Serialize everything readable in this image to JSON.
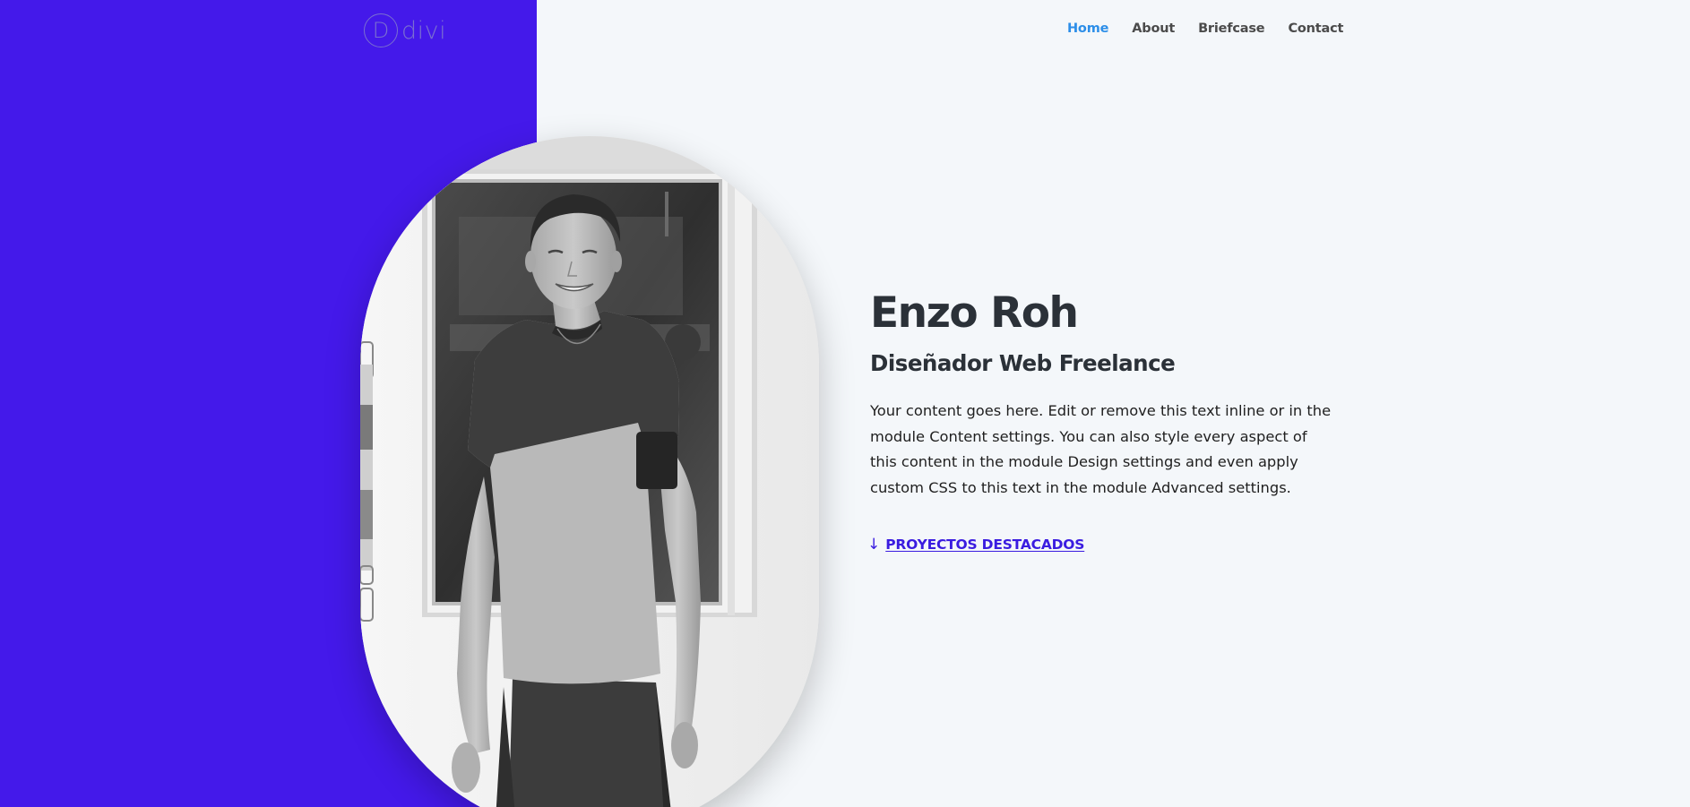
{
  "brand": {
    "logo_letter": "D",
    "logo_text": "divi"
  },
  "nav": {
    "items": [
      {
        "label": "Home",
        "active": true
      },
      {
        "label": "About",
        "active": false
      },
      {
        "label": "Briefcase",
        "active": false
      },
      {
        "label": "Contact",
        "active": false
      }
    ]
  },
  "hero": {
    "name": "Enzo Roh",
    "role": "Diseñador Web Freelance",
    "body": "Your content goes here. Edit or remove this text inline or in the module Content settings. You can also style every aspect of this content in the module Design settings and even apply custom CSS to this text in the module Advanced settings.",
    "cta_icon": "arrow-down-icon",
    "cta_arrow": "↓",
    "cta_label": "PROYECTOS DESTACADOS"
  },
  "colors": {
    "accent": "#4419ea",
    "nav_active": "#2c8ee8",
    "heading": "#2b3138",
    "background": "#f4f7fa"
  }
}
